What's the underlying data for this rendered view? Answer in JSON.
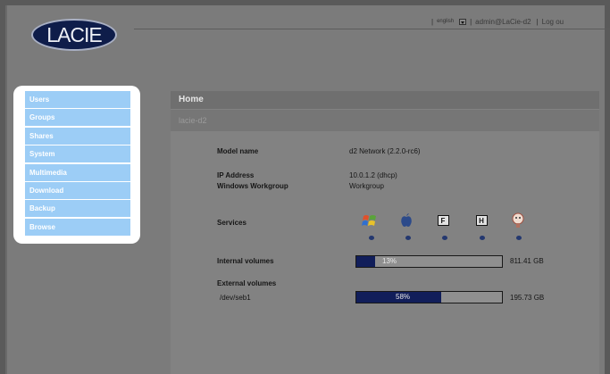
{
  "brand": {
    "logo_text": "LACIE"
  },
  "topbar": {
    "language": "english",
    "user": "admin@LaCie-d2",
    "logout": "Log ou"
  },
  "menu": {
    "items": [
      "Users",
      "Groups",
      "Shares",
      "System",
      "Multimedia",
      "Download",
      "Backup",
      "Browse"
    ]
  },
  "panel": {
    "title": "Home",
    "device": "lacie-d2"
  },
  "info": {
    "model_label": "Model name",
    "model_value": "d2 Network (2.2.0-rc6)",
    "ip_label": "IP Address",
    "ip_value": "10.0.1.2 (dhcp)",
    "workgroup_label": "Windows Workgroup",
    "workgroup_value": "Workgroup",
    "services_label": "Services"
  },
  "services": [
    {
      "icon": "windows-icon"
    },
    {
      "icon": "apple-icon"
    },
    {
      "icon": "ftp-icon",
      "label": "F"
    },
    {
      "icon": "http-icon",
      "label": "H"
    },
    {
      "icon": "bonjour-icon"
    }
  ],
  "volumes": {
    "internal_label": "Internal volumes",
    "internal": {
      "percent": 13,
      "percent_text": "13%",
      "size": "811.41 GB"
    },
    "external_label": "External volumes",
    "external": {
      "name": "/dev/seb1",
      "percent": 58,
      "percent_text": "58%",
      "size": "195.73 GB"
    }
  },
  "colors": {
    "menu_item": "#9ccdf6",
    "bar_fill": "#111e5a",
    "logo": "#0f1d4a"
  }
}
